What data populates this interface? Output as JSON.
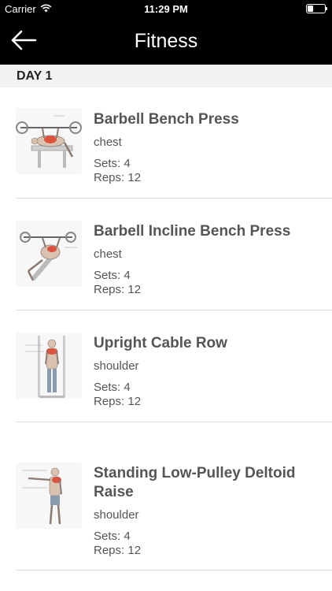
{
  "status": {
    "carrier": "Carrier",
    "time": "11:29 PM",
    "battery_level": 0.35
  },
  "nav": {
    "title": "Fitness",
    "back_icon": "arrow-left-icon"
  },
  "section": {
    "title": "DAY 1"
  },
  "exercises": [
    {
      "name": "Barbell Bench Press",
      "muscle": "chest",
      "sets": "Sets: 4",
      "reps": "Reps: 12",
      "icon": "bench-press-illustration"
    },
    {
      "name": "Barbell Incline Bench Press",
      "muscle": "chest",
      "sets": "Sets: 4",
      "reps": "Reps: 12",
      "icon": "incline-bench-press-illustration"
    },
    {
      "name": "Upright Cable Row",
      "muscle": "shoulder",
      "sets": "Sets: 4",
      "reps": "Reps: 12",
      "icon": "cable-row-illustration"
    },
    {
      "name": "Standing Low-Pulley Deltoid Raise",
      "muscle": "shoulder",
      "sets": "Sets: 4",
      "reps": "Reps: 12",
      "icon": "deltoid-raise-illustration"
    }
  ]
}
